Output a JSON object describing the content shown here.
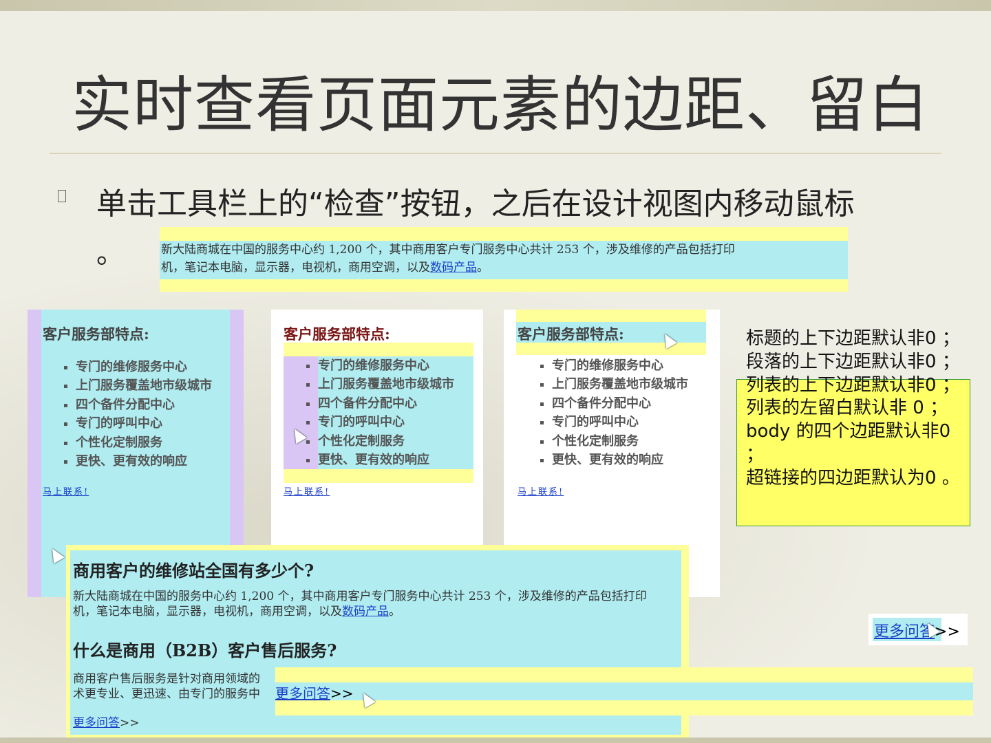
{
  "slide": {
    "title": "实时查看页面元素的边距、留白",
    "bullet_icon": "square-bullet-icon",
    "bullet": "单击工具栏上的“检查”按钮，之后在设计视图内移动鼠标",
    "bullet_tail": "。"
  },
  "top_sample": {
    "text1": "新大陆商城在中国的服务中心约 1,200 个，其中商用客户专门服务中心共计 253 个，涉及维修的产品包括打印",
    "text2": "机，笔记本电脑，显示器，电视机，商用空调，以及",
    "link": "数码产品",
    "end": "。"
  },
  "panels": [
    {
      "title": "客户服务部特点:",
      "items": [
        "专门的维修服务中心",
        "上门服务覆盖地市级城市",
        "四个备件分配中心",
        "专门的呼叫中心",
        "个性化定制服务",
        "更快、更有效的响应"
      ],
      "link": "马上联系!"
    },
    {
      "title": "客户服务部特点:",
      "items": [
        "专门的维修服务中心",
        "上门服务覆盖地市级城市",
        "四个备件分配中心",
        "专门的呼叫中心",
        "个性化定制服务",
        "更快、更有效的响应"
      ],
      "link": "马上联系!"
    },
    {
      "title": "客户服务部特点:",
      "items": [
        "专门的维修服务中心",
        "上门服务覆盖地市级城市",
        "四个备件分配中心",
        "专门的呼叫中心",
        "个性化定制服务",
        "更快、更有效的响应"
      ],
      "link": "马上联系!"
    }
  ],
  "notes": [
    "标题的上下边距默认非0 ；",
    "段落的上下边距默认非0 ；",
    "列表的上下边距默认非0 ；",
    "列表的左留白默认非 0 ；",
    "body 的四个边距默认非0 ；",
    "超链接的四边距默认为0 。"
  ],
  "more_qa": {
    "link": "更多问答",
    "arrow": ">>"
  },
  "big_sample": {
    "h1": "商用客户的维修站全国有多少个?",
    "p1a": "新大陆商城在中国的服务中心约 1,200 个，其中商用客户专门服务中心共计 253 个，涉及维修的产品包括打印",
    "p1b": "机，笔记本电脑，显示器，电视机，商用空调，以及",
    "p1link": "数码产品",
    "p1end": "。",
    "h2": "什么是商用（B2B）客户售后服务?",
    "p2a": "商用客户售后服务是针对商用领域的",
    "p2b": "术更专业、更迅速、由专门的服务中",
    "more": "更多问答",
    "arrow": ">>"
  },
  "strip": {
    "link": "更多问答",
    "arrow": ">>"
  },
  "colors": {
    "highlight_yellow": "#ffff99",
    "highlight_cyan": "#b0ecf0",
    "highlight_purple": "#d9c6f4",
    "link": "#1a3ec8"
  }
}
